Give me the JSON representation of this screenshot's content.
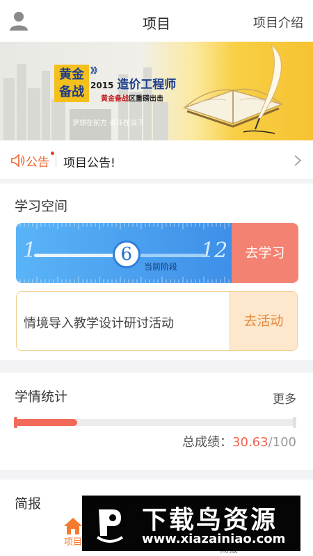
{
  "header": {
    "title": "项目",
    "right_link": "项目介绍"
  },
  "banner": {
    "badge_lines": [
      "黄金",
      "备战"
    ],
    "arrows": "》》",
    "year": "2015",
    "headline": "造价工程师",
    "sub_highlight": "黄金备战",
    "sub_rest": "区重磅出击",
    "slogan": "梦想在前方 奋斗在当下"
  },
  "notice": {
    "tag": "公告",
    "text": "项目公告!"
  },
  "study_space": {
    "title": "学习空间",
    "stage_min": "1",
    "stage_max": "12",
    "current_stage": "6",
    "current_stage_value": 6,
    "stage_label": "当前阶段",
    "go_study": "去学习",
    "activity_text": "情境导入教学设计研讨活动",
    "activity_button": "去活动"
  },
  "stats": {
    "title": "学情统计",
    "more": "更多",
    "score_label": "总成绩：",
    "score_value": "30.63",
    "score_total": "/100",
    "progress_fraction": 0.22
  },
  "brief": {
    "title": "简报"
  },
  "tabbar": {
    "home_label": "项目",
    "brief_label": "简报"
  },
  "watermark": {
    "title": "下载鸟资源",
    "url": "www.xiazainiao.com"
  },
  "colors": {
    "accent_orange": "#f47a2e",
    "score_red": "#f2634f",
    "ruler_blue": "#3e8fe8",
    "study_button": "#f48272",
    "activity_bg": "#fde8cd"
  }
}
